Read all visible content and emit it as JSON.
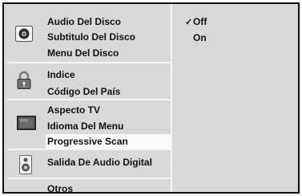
{
  "menu": {
    "groups": [
      {
        "icon": "disc-icon",
        "items": [
          "Audio Del Disco",
          "Subtitulo Del Disco",
          "Menu Del Disco"
        ]
      },
      {
        "icon": "lock-icon",
        "items": [
          "Indice",
          "Código Del País"
        ]
      },
      {
        "icon": "tv-icon",
        "items": [
          "Aspecto TV",
          "Idioma Del Menu",
          "Progressive Scan"
        ]
      },
      {
        "icon": "speaker-icon",
        "items": [
          "Salida De Audio Digital"
        ]
      },
      {
        "icon": "",
        "items": [
          "Otros"
        ]
      }
    ],
    "selected_item": "Progressive Scan"
  },
  "options": {
    "check_mark": "✓",
    "items": [
      "Off",
      "On"
    ],
    "checked": "Off"
  }
}
